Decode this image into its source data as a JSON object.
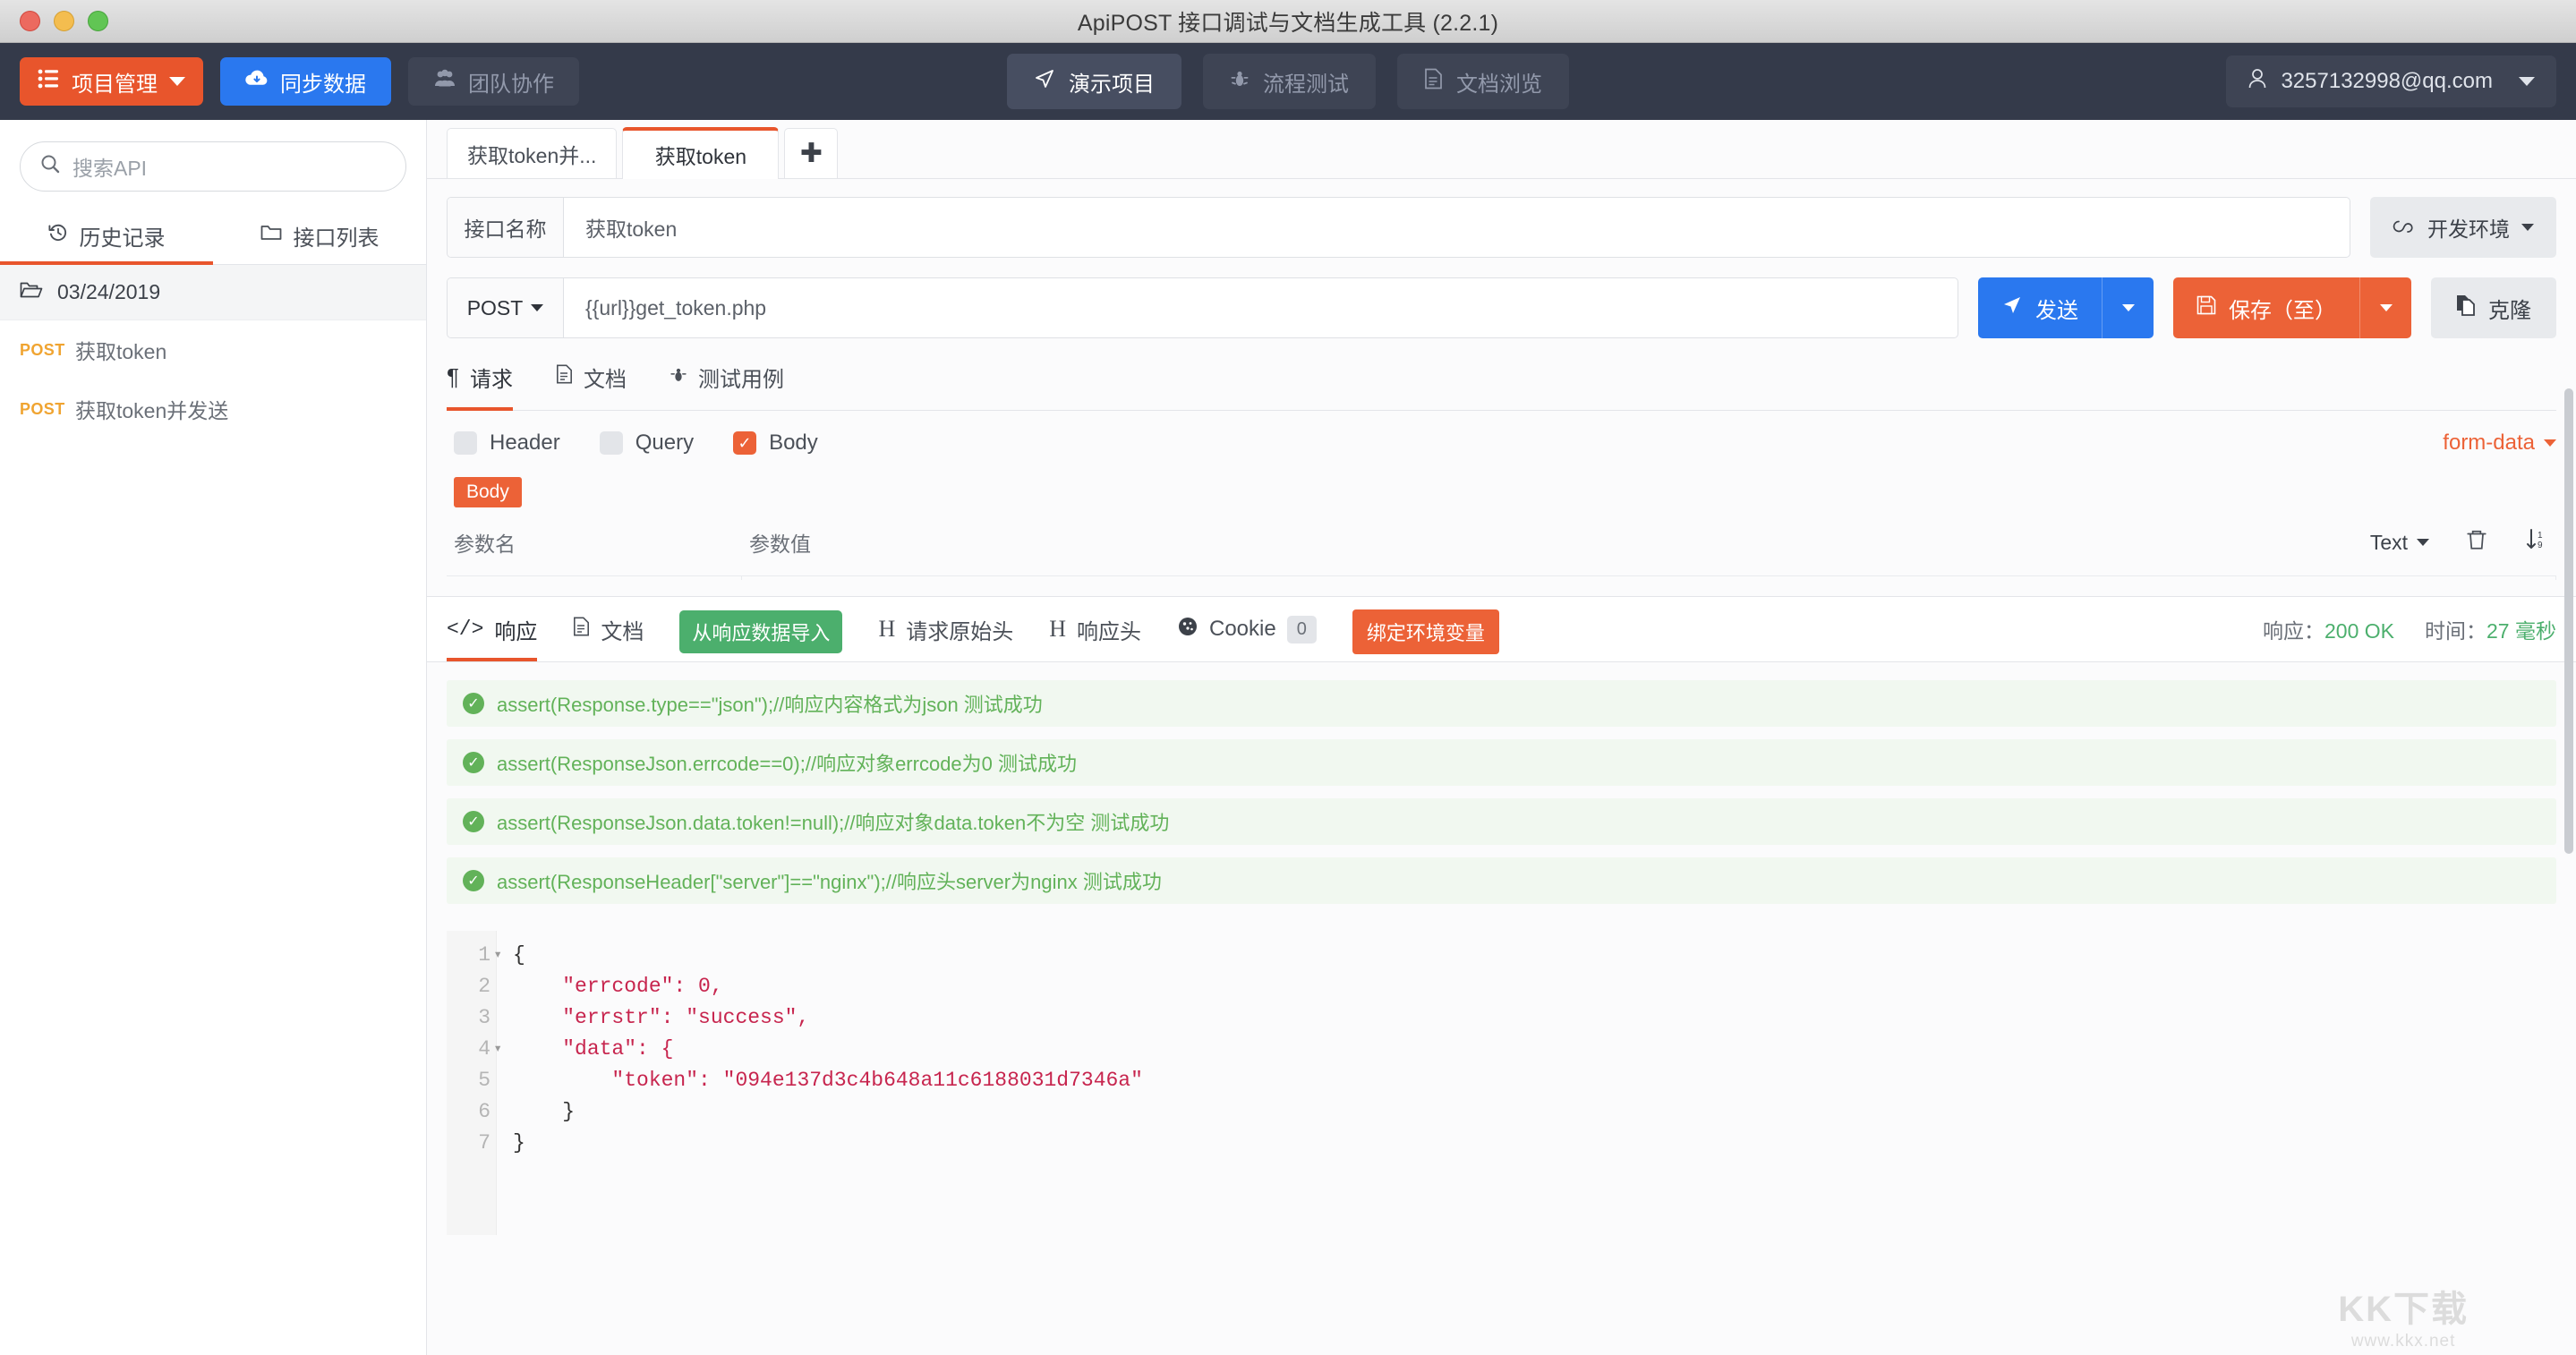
{
  "window": {
    "title": "ApiPOST 接口调试与文档生成工具 (2.2.1)"
  },
  "appbar": {
    "project_button": "项目管理",
    "sync_button": "同步数据",
    "team_button": "团队协作",
    "nav": [
      {
        "label": "演示项目",
        "icon": "send-icon",
        "active": true
      },
      {
        "label": "流程测试",
        "icon": "bug-icon",
        "active": false
      },
      {
        "label": "文档浏览",
        "icon": "document-icon",
        "active": false
      }
    ],
    "user": "3257132998@qq.com"
  },
  "sidebar": {
    "search_placeholder": "搜索API",
    "tabs": [
      {
        "label": "历史记录",
        "icon": "history-icon",
        "active": true
      },
      {
        "label": "接口列表",
        "icon": "folder-icon",
        "active": false
      }
    ],
    "folder": "03/24/2019",
    "items": [
      {
        "method": "POST",
        "name": "获取token"
      },
      {
        "method": "POST",
        "name": "获取token并发送"
      }
    ]
  },
  "doc_tabs": [
    {
      "label": "获取token并...",
      "active": false
    },
    {
      "label": "获取token",
      "active": true
    }
  ],
  "request": {
    "name_label": "接口名称",
    "name_value": "获取token",
    "env_button": "开发环境",
    "method": "POST",
    "url": "{{url}}get_token.php",
    "send_button": "发送",
    "save_button": "保存（至）",
    "clone_button": "克隆",
    "tabs": [
      {
        "label": "请求",
        "icon": "paragraph-icon",
        "active": true
      },
      {
        "label": "文档",
        "icon": "document-icon",
        "active": false
      },
      {
        "label": "测试用例",
        "icon": "bug-icon",
        "active": false
      }
    ],
    "checks": [
      {
        "label": "Header",
        "checked": false
      },
      {
        "label": "Query",
        "checked": false
      },
      {
        "label": "Body",
        "checked": true
      }
    ],
    "body_type": "form-data",
    "body_tag": "Body",
    "param_name_header": "参数名",
    "param_value_header": "参数值",
    "value_type": "Text"
  },
  "response": {
    "tabs": [
      {
        "label": "响应",
        "icon": "code-icon",
        "active": true
      },
      {
        "label": "文档",
        "icon": "document-icon",
        "active": false
      },
      {
        "label": "请求原始头",
        "icon": "header-h-icon",
        "active": false
      },
      {
        "label": "响应头",
        "icon": "header-h-icon",
        "active": false
      },
      {
        "label": "Cookie",
        "icon": "cookie-icon",
        "active": false
      }
    ],
    "import_button": "从响应数据导入",
    "cookie_count": "0",
    "bind_env_button": "绑定环境变量",
    "status_label": "响应：",
    "status_value": "200 OK",
    "time_label": "时间：",
    "time_value": "27 毫秒",
    "assertions": [
      "assert(Response.type==\"json\");//响应内容格式为json 测试成功",
      "assert(ResponseJson.errcode==0);//响应对象errcode为0 测试成功",
      "assert(ResponseJson.data.token!=null);//响应对象data.token不为空 测试成功",
      "assert(ResponseHeader[\"server\"]==\"nginx\");//响应头server为nginx 测试成功"
    ],
    "body_lines": [
      {
        "n": "1",
        "fold": true,
        "text": "{"
      },
      {
        "n": "2",
        "fold": false,
        "text": "    \"errcode\": 0,"
      },
      {
        "n": "3",
        "fold": false,
        "text": "    \"errstr\": \"success\","
      },
      {
        "n": "4",
        "fold": true,
        "text": "    \"data\": {"
      },
      {
        "n": "5",
        "fold": false,
        "text": "        \"token\": \"094e137d3c4b648a11c6188031d7346a\""
      },
      {
        "n": "6",
        "fold": false,
        "text": "    }"
      },
      {
        "n": "7",
        "fold": false,
        "text": "}"
      }
    ],
    "token_value": "094e137d3c4b648a11c6188031d7346a",
    "errcode": "0",
    "errstr": "success"
  },
  "watermark": {
    "big": "KK下载",
    "small": "www.kkx.net"
  },
  "colors": {
    "accent_orange": "#e8552c",
    "blue": "#2a78ef",
    "green": "#4caf6d",
    "dark_header": "#343a4a"
  }
}
